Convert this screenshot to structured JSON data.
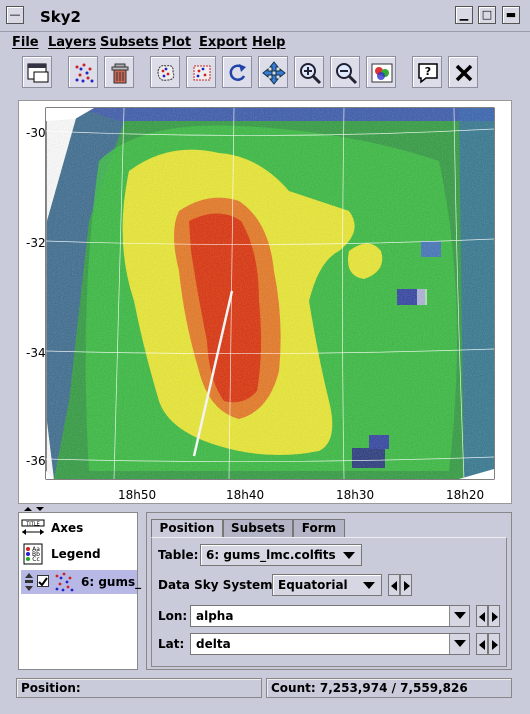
{
  "window": {
    "title": "Sky2"
  },
  "menu": [
    "File",
    "Layers",
    "Subsets",
    "Plot",
    "Export",
    "Help"
  ],
  "toolbar": {
    "icons": [
      "new-window-icon",
      "scatter-layer-icon",
      "delete-icon",
      "subset-blob-icon",
      "subset-rect-icon",
      "reload-icon",
      "pan-axes-icon",
      "zoom-in-icon",
      "zoom-out-icon",
      "image-export-icon",
      "help-icon",
      "close-icon"
    ]
  },
  "plot": {
    "y_ticks": [
      "-30",
      "-32",
      "-34",
      "-36"
    ],
    "x_ticks": [
      "18h50",
      "18h40",
      "18h30",
      "18h20"
    ],
    "colors": {
      "density_low": "#3344aa",
      "density_mid": "#22bb33",
      "density_high": "#eeee22",
      "density_peak": "#dd2200"
    }
  },
  "control_list": {
    "items": [
      {
        "label": "Axes",
        "icon": "axes-icon"
      },
      {
        "label": "Legend",
        "icon": "legend-icon"
      },
      {
        "label": "6: gums_",
        "icon": "scatter-layer-icon",
        "checked": true
      }
    ]
  },
  "tabs": [
    "Position",
    "Subsets",
    "Form"
  ],
  "position_tab": {
    "table_label": "Table:",
    "table_value": "6: gums_lmc.colfits",
    "sky_system_label": "Data Sky System:",
    "sky_system_value": "Equatorial",
    "lon_label": "Lon:",
    "lon_value": "alpha",
    "lat_label": "Lat:",
    "lat_value": "delta"
  },
  "status": {
    "position_label": "Position:",
    "count_text": "Count: 7,253,974 / 7,559,826"
  }
}
